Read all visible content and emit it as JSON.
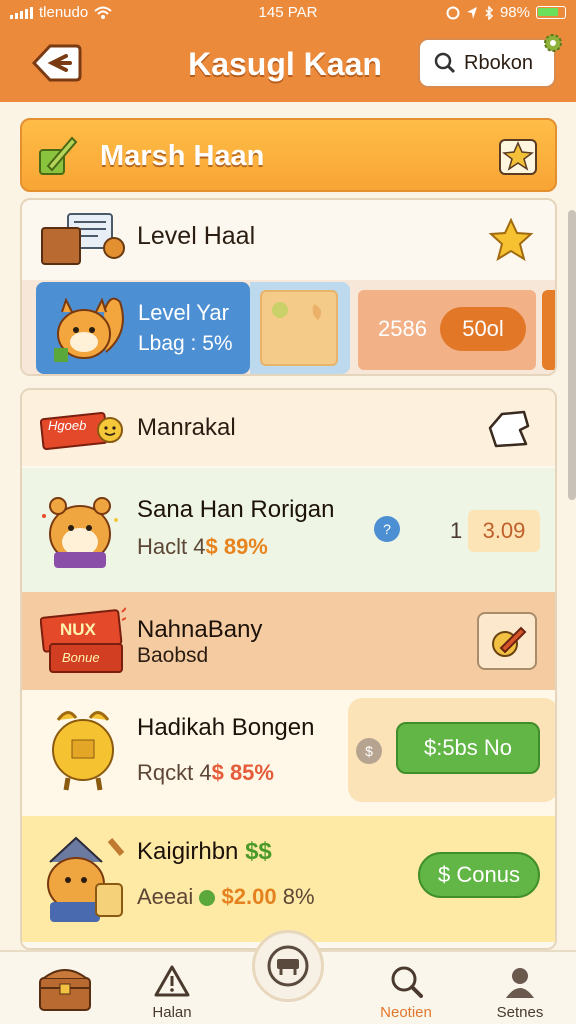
{
  "status": {
    "carrier": "tlenudo",
    "time": "145 PAR",
    "battery": "98%"
  },
  "header": {
    "title": "Kasugl Kaan",
    "search_label": "Rbokon"
  },
  "banner": {
    "title": "Marsh Haan"
  },
  "level_card": {
    "title": "Level Haal",
    "active_title": "Level Yar",
    "active_sub": "Lbag : 5%",
    "score": "2586",
    "pill": "50ol"
  },
  "section": {
    "title": "Manrakal",
    "badge": "Hgoeb",
    "rows": [
      {
        "title": "Sana Han Rorigan",
        "sub_prefix": "Haclt 4",
        "sub_value": "$ 89%",
        "price_prefix": "1",
        "price": "3.09"
      },
      {
        "title": "NahnaBany",
        "sub": "Baobsd",
        "box_label_1": "NUX",
        "box_label_2": "Bonue"
      },
      {
        "title": "Hadikah Bongen",
        "sub_prefix": "Rqckt 4",
        "sub_value": "$ 85%",
        "button": "$:5bs No",
        "info": "$"
      },
      {
        "title": "Kaigirhbn",
        "title_suffix": "$$",
        "sub_prefix": "Aeeai",
        "sub_value": "$2.00",
        "sub_suffix": "8%",
        "button": "$ Conus"
      }
    ]
  },
  "tabs": [
    {
      "label": ""
    },
    {
      "label": "Halan"
    },
    {
      "label": ""
    },
    {
      "label": "Neotien"
    },
    {
      "label": "Setnes"
    }
  ],
  "colors": {
    "header": "#ec8a3c",
    "banner": "#ffb23e",
    "active_tab": "#e2772a",
    "green": "#62b646"
  }
}
